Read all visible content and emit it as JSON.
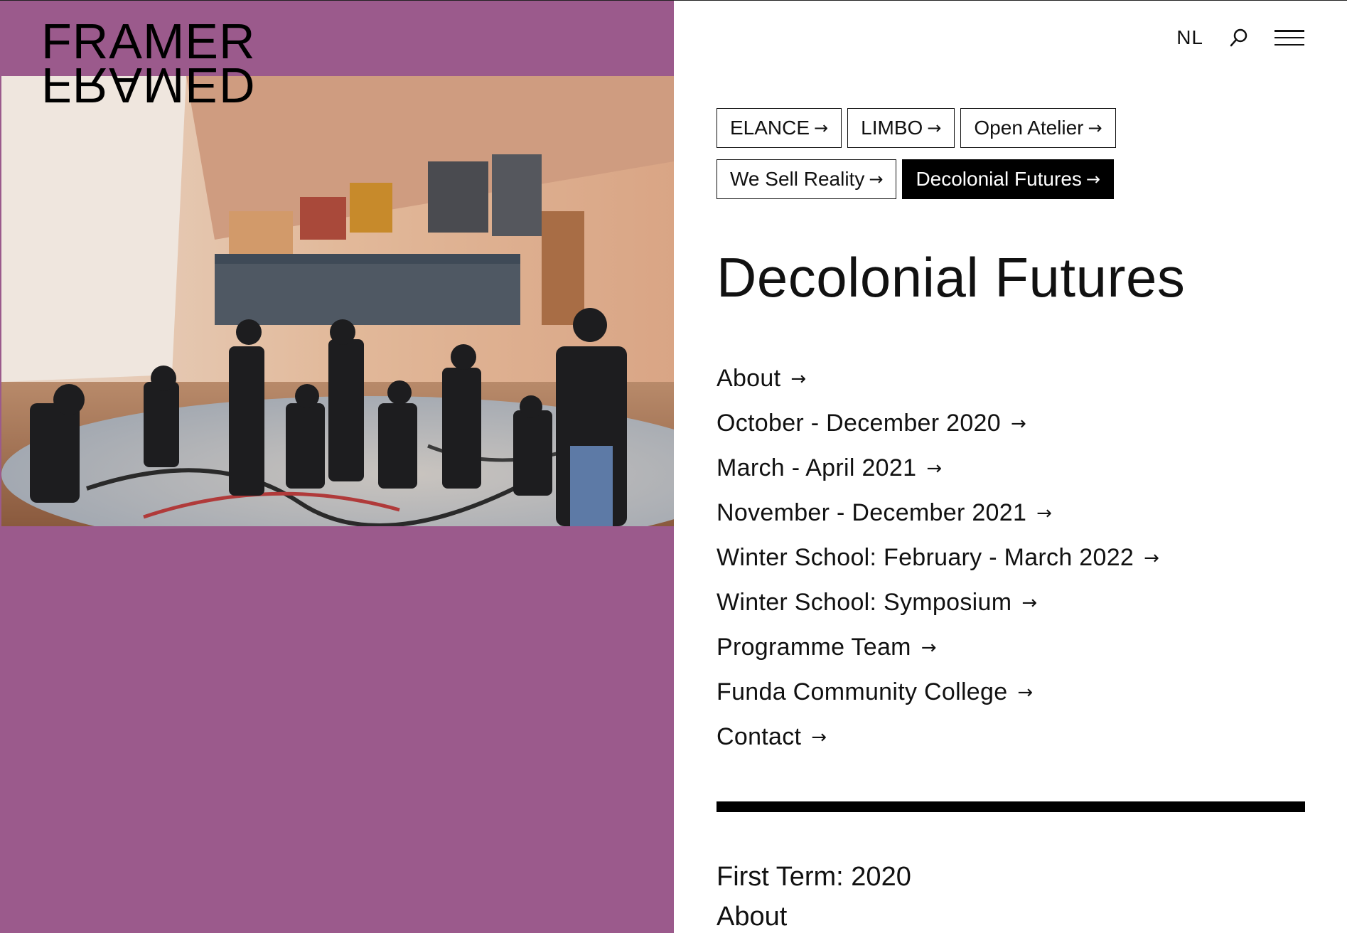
{
  "brand": {
    "logo_top": "FRAMER",
    "logo_bottom": "FRAMED",
    "panel_color": "#9b5a8c"
  },
  "nav": {
    "language": "NL",
    "search_icon": "search-icon",
    "menu_icon": "hamburger-menu-icon"
  },
  "projects": [
    {
      "label": "ELANCE",
      "active": false
    },
    {
      "label": "LIMBO",
      "active": false
    },
    {
      "label": "Open Atelier",
      "active": false
    },
    {
      "label": "We Sell Reality",
      "active": false
    },
    {
      "label": "Decolonial Futures",
      "active": true
    }
  ],
  "arrow": "→",
  "page": {
    "title": "Decolonial Futures"
  },
  "links": [
    "About",
    "October - December 2020",
    "March - April 2021",
    "November - December 2021",
    "Winter School: February - March 2022",
    "Winter School: Symposium",
    "Programme Team",
    "Funda Community College",
    "Contact"
  ],
  "section": {
    "line1": "First Term: 2020",
    "line2": "About"
  }
}
